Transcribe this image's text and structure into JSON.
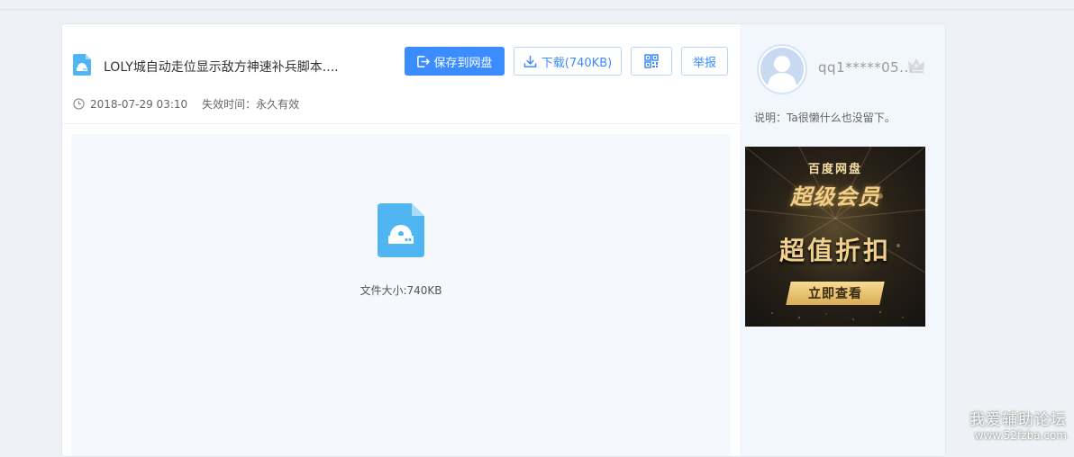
{
  "file": {
    "name": "LOLY城自动走位显示敌方神速补兵脚本....",
    "date": "2018-07-29 03:10",
    "expire": "失效时间：永久有效",
    "size_text": "文件大小:740KB",
    "icon": "disk-file-icon"
  },
  "toolbar": {
    "save_label": "保存到网盘",
    "download_label": "下载(740KB)",
    "qr_icon": "qrcode-icon",
    "report_label": "举报"
  },
  "sidebar": {
    "username": "qq1*****05...",
    "description": "说明：Ta很懒什么也没留下。",
    "ad": {
      "brand": "百度网盘",
      "vip": "超级会员",
      "deal": "超值折扣",
      "cta": "立即查看"
    }
  },
  "watermark": {
    "title": "我爱辅助论坛",
    "url": "www.52fzba.com"
  },
  "colors": {
    "accent": "#3b8cff",
    "file_icon": "#4fb6f3",
    "page_bg": "#eef1f6",
    "preview_bg": "#f5f8fd",
    "sidebar_bg": "#f2f6fd",
    "ad_gold": "#f0d08c"
  }
}
